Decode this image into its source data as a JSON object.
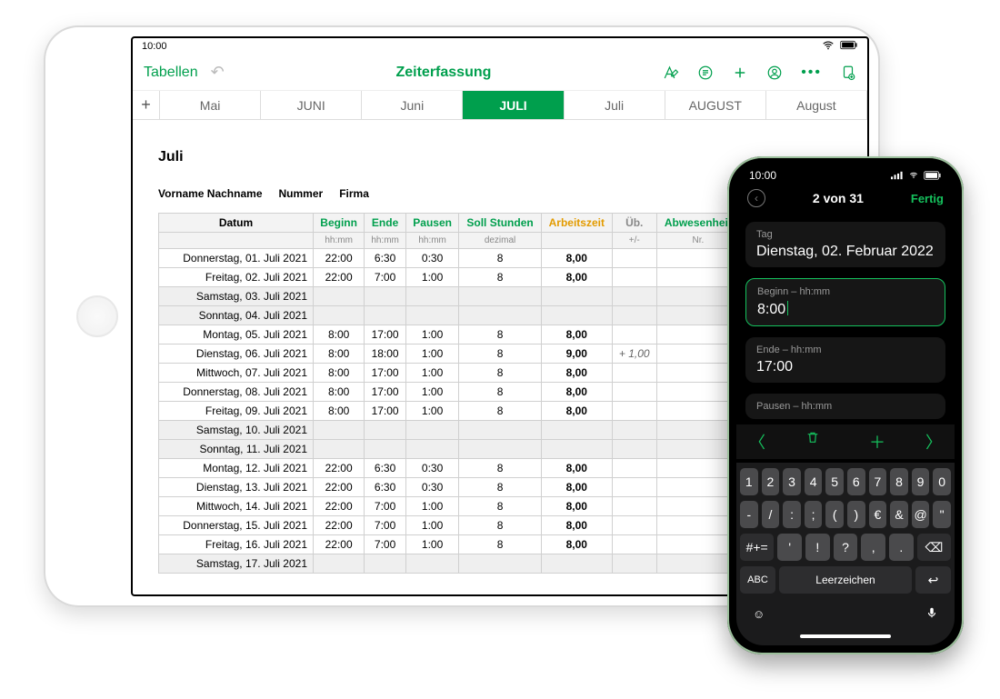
{
  "ipad": {
    "status_time": "10:00",
    "nav": {
      "back_label": "Tabellen",
      "title": "Zeiterfassung"
    },
    "tabs": [
      "Mai",
      "JUNI",
      "Juni",
      "JULI",
      "Juli",
      "AUGUST",
      "August"
    ],
    "active_tab_index": 3,
    "sheet": {
      "month_title": "Juli",
      "meta": {
        "name": "Vorname Nachname",
        "number": "Nummer",
        "firma": "Firma"
      },
      "headers": {
        "datum": "Datum",
        "beginn": "Beginn",
        "ende": "Ende",
        "pausen": "Pausen",
        "soll": "Soll Stunden",
        "arbeitszeit": "Arbeitszeit",
        "ueb": "Üb.",
        "abwesenheit": "Abwesenheit"
      },
      "subheaders": {
        "beginn": "hh:mm",
        "ende": "hh:mm",
        "pausen": "hh:mm",
        "soll": "dezimal",
        "ueb": "+/-",
        "abwesenheit": "Nr."
      },
      "rows": [
        {
          "date": "Donnerstag, 01. Juli 2021",
          "b": "22:00",
          "e": "6:30",
          "p": "0:30",
          "s": "8",
          "a": "8,00"
        },
        {
          "date": "Freitag, 02. Juli 2021",
          "b": "22:00",
          "e": "7:00",
          "p": "1:00",
          "s": "8",
          "a": "8,00"
        },
        {
          "date": "Samstag, 03. Juli 2021",
          "weekend": true
        },
        {
          "date": "Sonntag, 04. Juli 2021",
          "weekend": true
        },
        {
          "date": "Montag, 05. Juli 2021",
          "b": "8:00",
          "e": "17:00",
          "p": "1:00",
          "s": "8",
          "a": "8,00"
        },
        {
          "date": "Dienstag, 06. Juli 2021",
          "b": "8:00",
          "e": "18:00",
          "p": "1:00",
          "s": "8",
          "a": "9,00",
          "u": "+ 1,00"
        },
        {
          "date": "Mittwoch, 07. Juli 2021",
          "b": "8:00",
          "e": "17:00",
          "p": "1:00",
          "s": "8",
          "a": "8,00"
        },
        {
          "date": "Donnerstag, 08. Juli 2021",
          "b": "8:00",
          "e": "17:00",
          "p": "1:00",
          "s": "8",
          "a": "8,00"
        },
        {
          "date": "Freitag, 09. Juli 2021",
          "b": "8:00",
          "e": "17:00",
          "p": "1:00",
          "s": "8",
          "a": "8,00"
        },
        {
          "date": "Samstag, 10. Juli 2021",
          "weekend": true
        },
        {
          "date": "Sonntag, 11. Juli 2021",
          "weekend": true
        },
        {
          "date": "Montag, 12. Juli 2021",
          "b": "22:00",
          "e": "6:30",
          "p": "0:30",
          "s": "8",
          "a": "8,00"
        },
        {
          "date": "Dienstag, 13. Juli 2021",
          "b": "22:00",
          "e": "6:30",
          "p": "0:30",
          "s": "8",
          "a": "8,00"
        },
        {
          "date": "Mittwoch, 14. Juli 2021",
          "b": "22:00",
          "e": "7:00",
          "p": "1:00",
          "s": "8",
          "a": "8,00"
        },
        {
          "date": "Donnerstag, 15. Juli 2021",
          "b": "22:00",
          "e": "7:00",
          "p": "1:00",
          "s": "8",
          "a": "8,00"
        },
        {
          "date": "Freitag, 16. Juli 2021",
          "b": "22:00",
          "e": "7:00",
          "p": "1:00",
          "s": "8",
          "a": "8,00"
        },
        {
          "date": "Samstag, 17. Juli 2021",
          "weekend": true
        }
      ]
    }
  },
  "iphone": {
    "status_time": "10:00",
    "nav": {
      "counter": "2 von 31",
      "done": "Fertig"
    },
    "fields": {
      "tag": {
        "lbl": "Tag",
        "val": "Dienstag, 02. Februar 2022"
      },
      "beginn": {
        "lbl": "Beginn – hh:mm",
        "val": "8:00"
      },
      "ende": {
        "lbl": "Ende – hh:mm",
        "val": "17:00"
      },
      "pausen": {
        "lbl": "Pausen – hh:mm"
      }
    },
    "keyboard": {
      "row1": [
        "1",
        "2",
        "3",
        "4",
        "5",
        "6",
        "7",
        "8",
        "9",
        "0"
      ],
      "row2": [
        "-",
        "/",
        ":",
        ";",
        "(",
        ")",
        "€",
        "&",
        "@",
        "\""
      ],
      "row3_mode": "#+=",
      "row3": [
        ".",
        ",",
        "?",
        "!",
        "'"
      ],
      "row4_mode": "ABC",
      "space": "Leerzeichen"
    }
  }
}
